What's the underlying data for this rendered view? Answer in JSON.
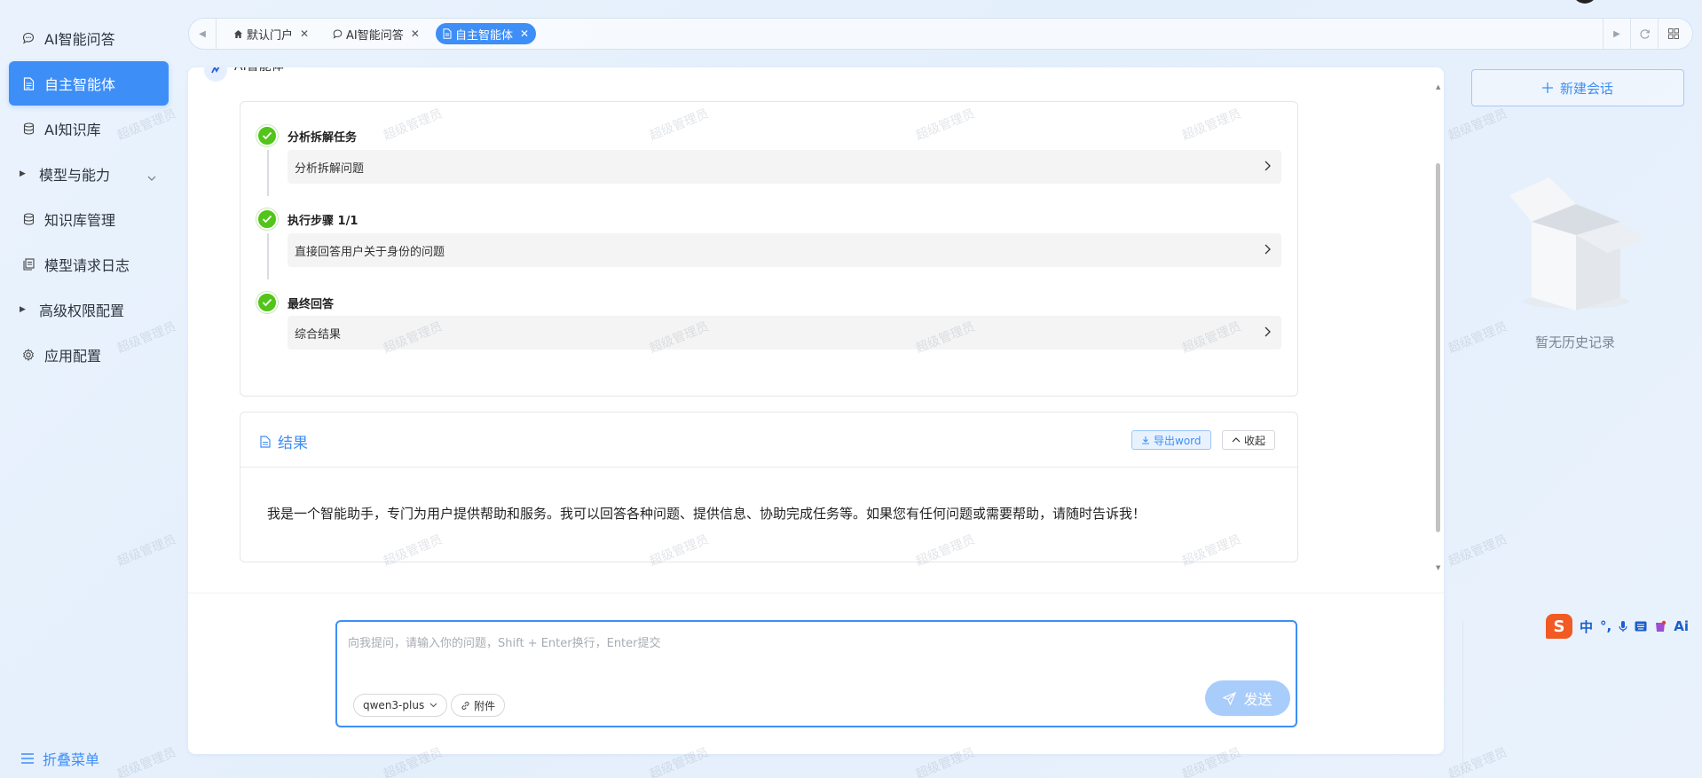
{
  "sidebar": {
    "items": [
      {
        "label": "AI智能问答",
        "icon": "chat-icon"
      },
      {
        "label": "自主智能体",
        "icon": "document-icon"
      },
      {
        "label": "AI知识库",
        "icon": "database-icon"
      },
      {
        "label": "模型与能力",
        "icon": "caret-right-icon"
      },
      {
        "label": "知识库管理",
        "icon": "database-icon"
      },
      {
        "label": "模型请求日志",
        "icon": "log-icon"
      },
      {
        "label": "高级权限配置",
        "icon": "caret-right-icon"
      },
      {
        "label": "应用配置",
        "icon": "gear-icon"
      }
    ],
    "active_index": 1,
    "collapse_label": "折叠菜单"
  },
  "tabs": [
    {
      "label": "默认门户",
      "icon": "home-icon"
    },
    {
      "label": "AI智能问答",
      "icon": "chat-icon"
    },
    {
      "label": "自主智能体",
      "icon": "document-icon"
    }
  ],
  "active_tab": 2,
  "agent": {
    "name": "AI智能体"
  },
  "steps": [
    {
      "title": "分析拆解任务",
      "detail": "分析拆解问题"
    },
    {
      "title": "执行步骤 1/1",
      "detail": "直接回答用户关于身份的问题"
    },
    {
      "title": "最终回答",
      "detail": "综合结果"
    }
  ],
  "result": {
    "title": "结果",
    "export_label": "导出word",
    "collapse_label": "收起",
    "text": "我是一个智能助手，专门为用户提供帮助和服务。我可以回答各种问题、提供信息、协助完成任务等。如果您有任何问题或需要帮助，请随时告诉我！"
  },
  "composer": {
    "placeholder": "向我提问，请输入你的问题，Shift + Enter换行，Enter提交",
    "value": "",
    "model": "qwen3-plus",
    "attach_label": "附件",
    "send_label": "发送"
  },
  "history": {
    "new_chat_label": "新建会话",
    "empty_label": "暂无历史记录"
  },
  "ime": {
    "logo": "S",
    "lang": "中",
    "punct": "°,",
    "ai": "Ai"
  },
  "watermark": "超级管理员",
  "colors": {
    "accent": "#3e8ef7",
    "success": "#52c41a",
    "send_disabled": "#a9cdfb"
  }
}
